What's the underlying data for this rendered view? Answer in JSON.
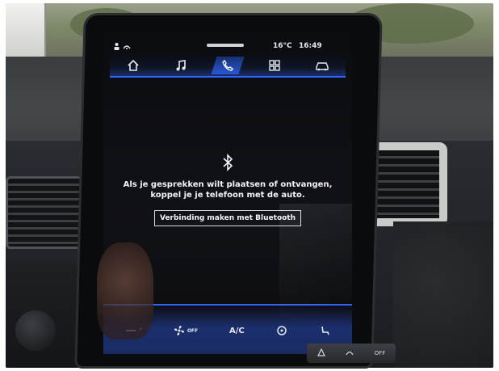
{
  "status_bar": {
    "temperature": "16°C",
    "time": "16:49"
  },
  "nav": {
    "items": [
      {
        "name": "home",
        "icon": "home-icon",
        "active": false
      },
      {
        "name": "music",
        "icon": "music-note-icon",
        "active": false
      },
      {
        "name": "phone",
        "icon": "phone-icon",
        "active": true
      },
      {
        "name": "apps",
        "icon": "grid-icon",
        "active": false
      },
      {
        "name": "vehicle",
        "icon": "car-icon",
        "active": false
      }
    ]
  },
  "phone": {
    "bluetooth_icon": "bluetooth-icon",
    "message": "Als je gesprekken wilt plaatsen of ontvangen, koppel je je telefoon met de auto.",
    "connect_label": "Verbinding maken met Bluetooth"
  },
  "climate": {
    "fan_off_label": "OFF",
    "ac_label": "A/C",
    "icons": [
      "fan-icon",
      "steering-wheel-heat-icon",
      "seat-heat-icon"
    ]
  },
  "physical_buttons": {
    "off_label": "OFF"
  },
  "colors": {
    "accent": "#2f64ff",
    "nav_active": "#2a58d6",
    "screen_bg": "#0c0d10"
  }
}
